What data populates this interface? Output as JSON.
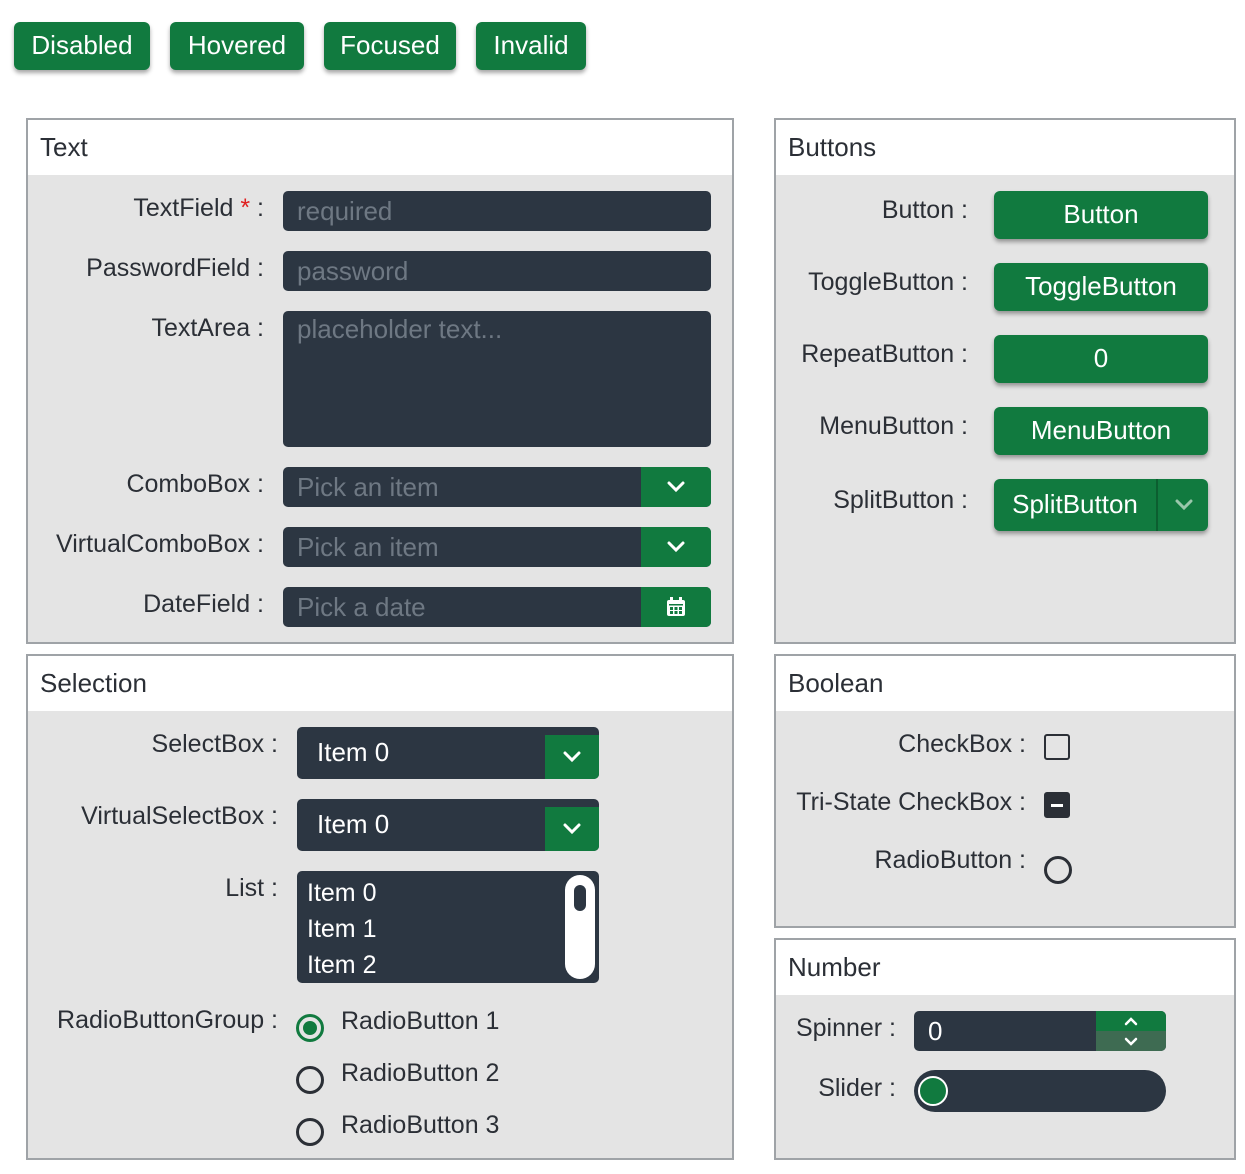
{
  "state_buttons": [
    "Disabled",
    "Hovered",
    "Focused",
    "Invalid"
  ],
  "text_panel": {
    "title": "Text",
    "textfield_label": "TextField",
    "required_mark": "*",
    "label_suffix": " :",
    "textfield_placeholder": "required",
    "password_label": "PasswordField :",
    "password_placeholder": "password",
    "textarea_label": "TextArea :",
    "textarea_placeholder": "placeholder text...",
    "combobox_label": "ComboBox :",
    "combobox_placeholder": "Pick an item",
    "virtual_combobox_label": "VirtualComboBox :",
    "virtual_combobox_placeholder": "Pick an item",
    "datefield_label": "DateField :",
    "datefield_placeholder": "Pick a date"
  },
  "buttons_panel": {
    "title": "Buttons",
    "button_label": "Button :",
    "button_text": "Button",
    "toggle_label": "ToggleButton :",
    "toggle_text": "ToggleButton",
    "repeat_label": "RepeatButton :",
    "repeat_text": "0",
    "menu_label": "MenuButton :",
    "menu_text": "MenuButton",
    "split_label": "SplitButton :",
    "split_text": "SplitButton"
  },
  "selection_panel": {
    "title": "Selection",
    "selectbox_label": "SelectBox :",
    "selectbox_value": "Item 0",
    "virtual_selectbox_label": "VirtualSelectBox :",
    "virtual_selectbox_value": "Item 0",
    "list_label": "List :",
    "list_items": [
      "Item 0",
      "Item 1",
      "Item 2"
    ],
    "radio_group_label": "RadioButtonGroup :",
    "radio_options": [
      "RadioButton 1",
      "RadioButton 2",
      "RadioButton 3"
    ],
    "radio_selected_index": 0
  },
  "boolean_panel": {
    "title": "Boolean",
    "checkbox_label": "CheckBox :",
    "checkbox_checked": false,
    "tristate_label": "Tri-State CheckBox :",
    "tristate_state": "indeterminate",
    "radiobutton_label": "RadioButton :",
    "radiobutton_checked": false
  },
  "number_panel": {
    "title": "Number",
    "spinner_label": "Spinner :",
    "spinner_value": "0",
    "slider_label": "Slider :",
    "slider_value_fraction": 0
  },
  "colors": {
    "accent": "#117a3f",
    "field_bg": "#2c3642",
    "panel_bg": "#e4e4e4"
  },
  "icons": [
    "chevron-down-icon",
    "calendar-icon",
    "chevron-up-icon"
  ]
}
